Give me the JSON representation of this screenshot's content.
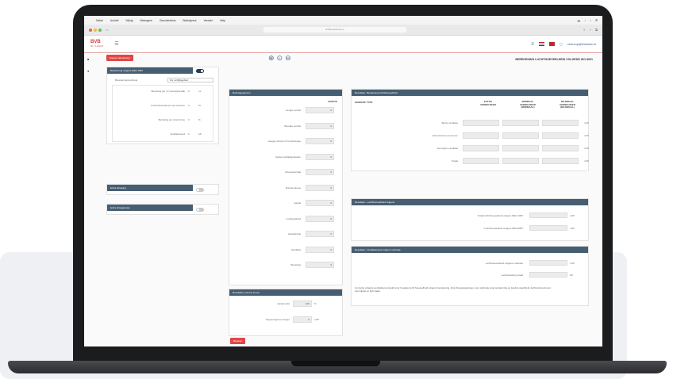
{
  "menubar": {
    "items": [
      "Safari",
      "Archief",
      "Wijzig",
      "Weergave",
      "Geschiedenis",
      "Bladwijzers",
      "Venster",
      "Help"
    ]
  },
  "browser": {
    "url": "lichtberekening.nl"
  },
  "header": {
    "logo": "BVB",
    "logo_sub": "NL / LUCHT",
    "email": "verkoop@bvbweb.nl"
  },
  "toolbar": {
    "back_button": "Nieuwe berekening",
    "page_title": "BEREKENING LUCHTHOEVEELHEID VOLGENS ISO 8001"
  },
  "left": {
    "panel_basis": {
      "title": "Berekening volgens NEN 1087",
      "select_label": "Berekeningsmethode",
      "select_value": "Per verblijfsgebied",
      "rows": [
        {
          "label": "Bezetting per m² vloeroppervlak",
          "value": "0",
          "unit": "m²"
        },
        {
          "label": "Luchtvolumestroom per persoon",
          "value": "0",
          "unit": "l/s"
        },
        {
          "label": "Bezetting per vloerruimte",
          "value": "0",
          "unit": "%"
        },
        {
          "label": "Ventilatievoud",
          "value": "0",
          "unit": "1/h"
        }
      ]
    },
    "panel_extra1": {
      "title": "Extra afzuiging"
    },
    "panel_extra2": {
      "title": "Extra afzuigpunten"
    }
  },
  "middle": {
    "panel_dims": {
      "title": "Ruimtegegevens",
      "col_header": "LENGTE",
      "rows": [
        {
          "label": "Lengte vertrek",
          "value": "0"
        },
        {
          "label": "Breedte vertrek",
          "value": "0"
        },
        {
          "label": "Hoogte vertrek of ruimtehoogte",
          "value": "0"
        },
        {
          "label": "Aantal verblijfsgebieden",
          "value": "0"
        },
        {
          "label": "Vloeroppervlak",
          "value": "0"
        },
        {
          "label": "Ruimtevolume",
          "value": "0"
        },
        {
          "label": "Aantal",
          "value": "0"
        },
        {
          "label": "Luchtsnelheid",
          "value": "0"
        },
        {
          "label": "Geluidsdruk",
          "value": "0"
        },
        {
          "label": "Ventilatie",
          "value": "0"
        },
        {
          "label": "Bezetting",
          "value": "0"
        }
      ]
    },
    "panel_result": {
      "title": "Resultaten externe invoer",
      "rows": [
        {
          "label": "Aantal units",
          "value": "100",
          "unit": "%"
        },
        {
          "label": "Toegevoegd vermogen",
          "value": "0",
          "unit": "m³/h"
        }
      ]
    },
    "calc_button": "Bereken"
  },
  "right": {
    "panel_a": {
      "title": "Resultaat - Berekening luchthoeveelheid",
      "group_label": "GEBRUIK TYPE",
      "col_headers": [
        "EXTRA\nVERBRUIKER",
        "MINIMAAL\nVERBRUIKER\n(MINIMAAL)",
        "MAXIMAAL\nVERBRUIKER\n(MAXIMAAL)"
      ],
      "rows": [
        {
          "label": "Bezet ventilatie",
          "unit": "m³/h"
        },
        {
          "label": "Volumestroom personen",
          "unit": "m³/h"
        },
        {
          "label": "Vermogen ventilatie",
          "unit": "m³/h"
        },
        {
          "label": "Totaal",
          "unit": "m³/h"
        }
      ]
    },
    "panel_b": {
      "title": "Resultaat - Luchthoeveelheid volgens",
      "rows": [
        {
          "label": "Totaal luchthoeveelheid volgens NEN 1087",
          "unit": "m³/h"
        },
        {
          "label": "Luchthoeveelheid volgens NEN 8087",
          "unit": "m³/h"
        }
      ]
    },
    "panel_c": {
      "title": "Resultaat - Ventilatievoud volgens methode",
      "rows": [
        {
          "label": "Luchthoeveelheid volgens methode",
          "unit": "m³/h"
        },
        {
          "label": "Luchtwisseling totaal",
          "unit": "1/h"
        }
      ],
      "note": "Correctie volgens ventilatievoud geldt voor hoogste lucht hoeveelheid volgens berekening. Zorg bij aanpassingen voor optimale vloerverwarming en koeling waarbij de luchtvolumestroom niet wijzigt en tijd maakt."
    }
  },
  "colors": {
    "accent": "#475e72",
    "brand_red": "#d43c3c",
    "link_blue": "#3f6a96"
  }
}
